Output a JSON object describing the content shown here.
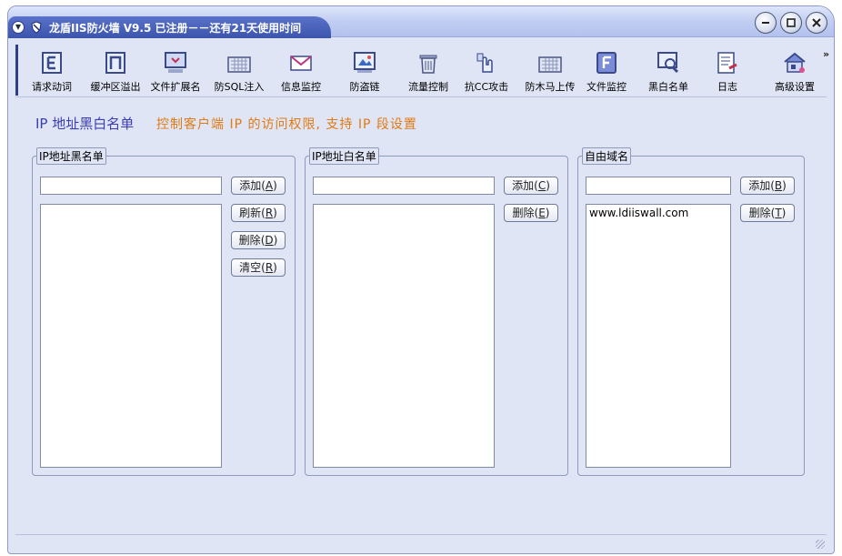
{
  "window": {
    "title": "龙盾IIS防火墙 V9.5 已注册－－还有21天使用时间"
  },
  "toolbar": {
    "items": [
      {
        "label": "请求动词",
        "icon": "letter-e-icon"
      },
      {
        "label": "缓冲区溢出",
        "icon": "letter-n-icon"
      },
      {
        "label": "文件扩展名",
        "icon": "monitor-heart-icon"
      },
      {
        "label": "防SQL注入",
        "icon": "keyboard-icon"
      },
      {
        "label": "信息监控",
        "icon": "envelope-icon"
      },
      {
        "label": "防盗链",
        "icon": "picture-icon"
      },
      {
        "label": "流量控制",
        "icon": "trash-bin-icon"
      },
      {
        "label": "抗CC攻击",
        "icon": "hand-pointer-icon"
      },
      {
        "label": "防木马上传",
        "icon": "keyboard-icon"
      },
      {
        "label": "文件监控",
        "icon": "letter-f-icon"
      },
      {
        "label": "黑白名单",
        "icon": "magnifier-monitor-icon"
      },
      {
        "label": "日志",
        "icon": "document-pen-icon"
      },
      {
        "label": "高级设置",
        "icon": "house-icon"
      }
    ],
    "more_label": "»"
  },
  "page": {
    "heading": "IP 地址黑白名单",
    "subheading": "控制客户端 IP 的访问权限, 支持 IP 段设置"
  },
  "blacklist": {
    "title": "IP地址黑名单",
    "input_value": "",
    "entries": [],
    "buttons": {
      "add": {
        "text": "添加",
        "key": "A"
      },
      "refresh": {
        "text": "刷新",
        "key": "R"
      },
      "delete": {
        "text": "删除",
        "key": "D"
      },
      "clear": {
        "text": "清空",
        "key": "R"
      }
    }
  },
  "whitelist": {
    "title": "IP地址白名单",
    "input_value": "",
    "entries": [],
    "buttons": {
      "add": {
        "text": "添加",
        "key": "C"
      },
      "delete": {
        "text": "删除",
        "key": "E"
      }
    }
  },
  "domains": {
    "title": "自由域名",
    "input_value": "",
    "entries": [
      "www.ldiiswall.com"
    ],
    "buttons": {
      "add": {
        "text": "添加",
        "key": "B"
      },
      "delete": {
        "text": "删除",
        "key": "T"
      }
    }
  },
  "colors": {
    "heading": "#3b3db5",
    "subheading": "#e07a12",
    "window_bg": "#dfe5f5",
    "title_bar": "#3c55ac"
  }
}
